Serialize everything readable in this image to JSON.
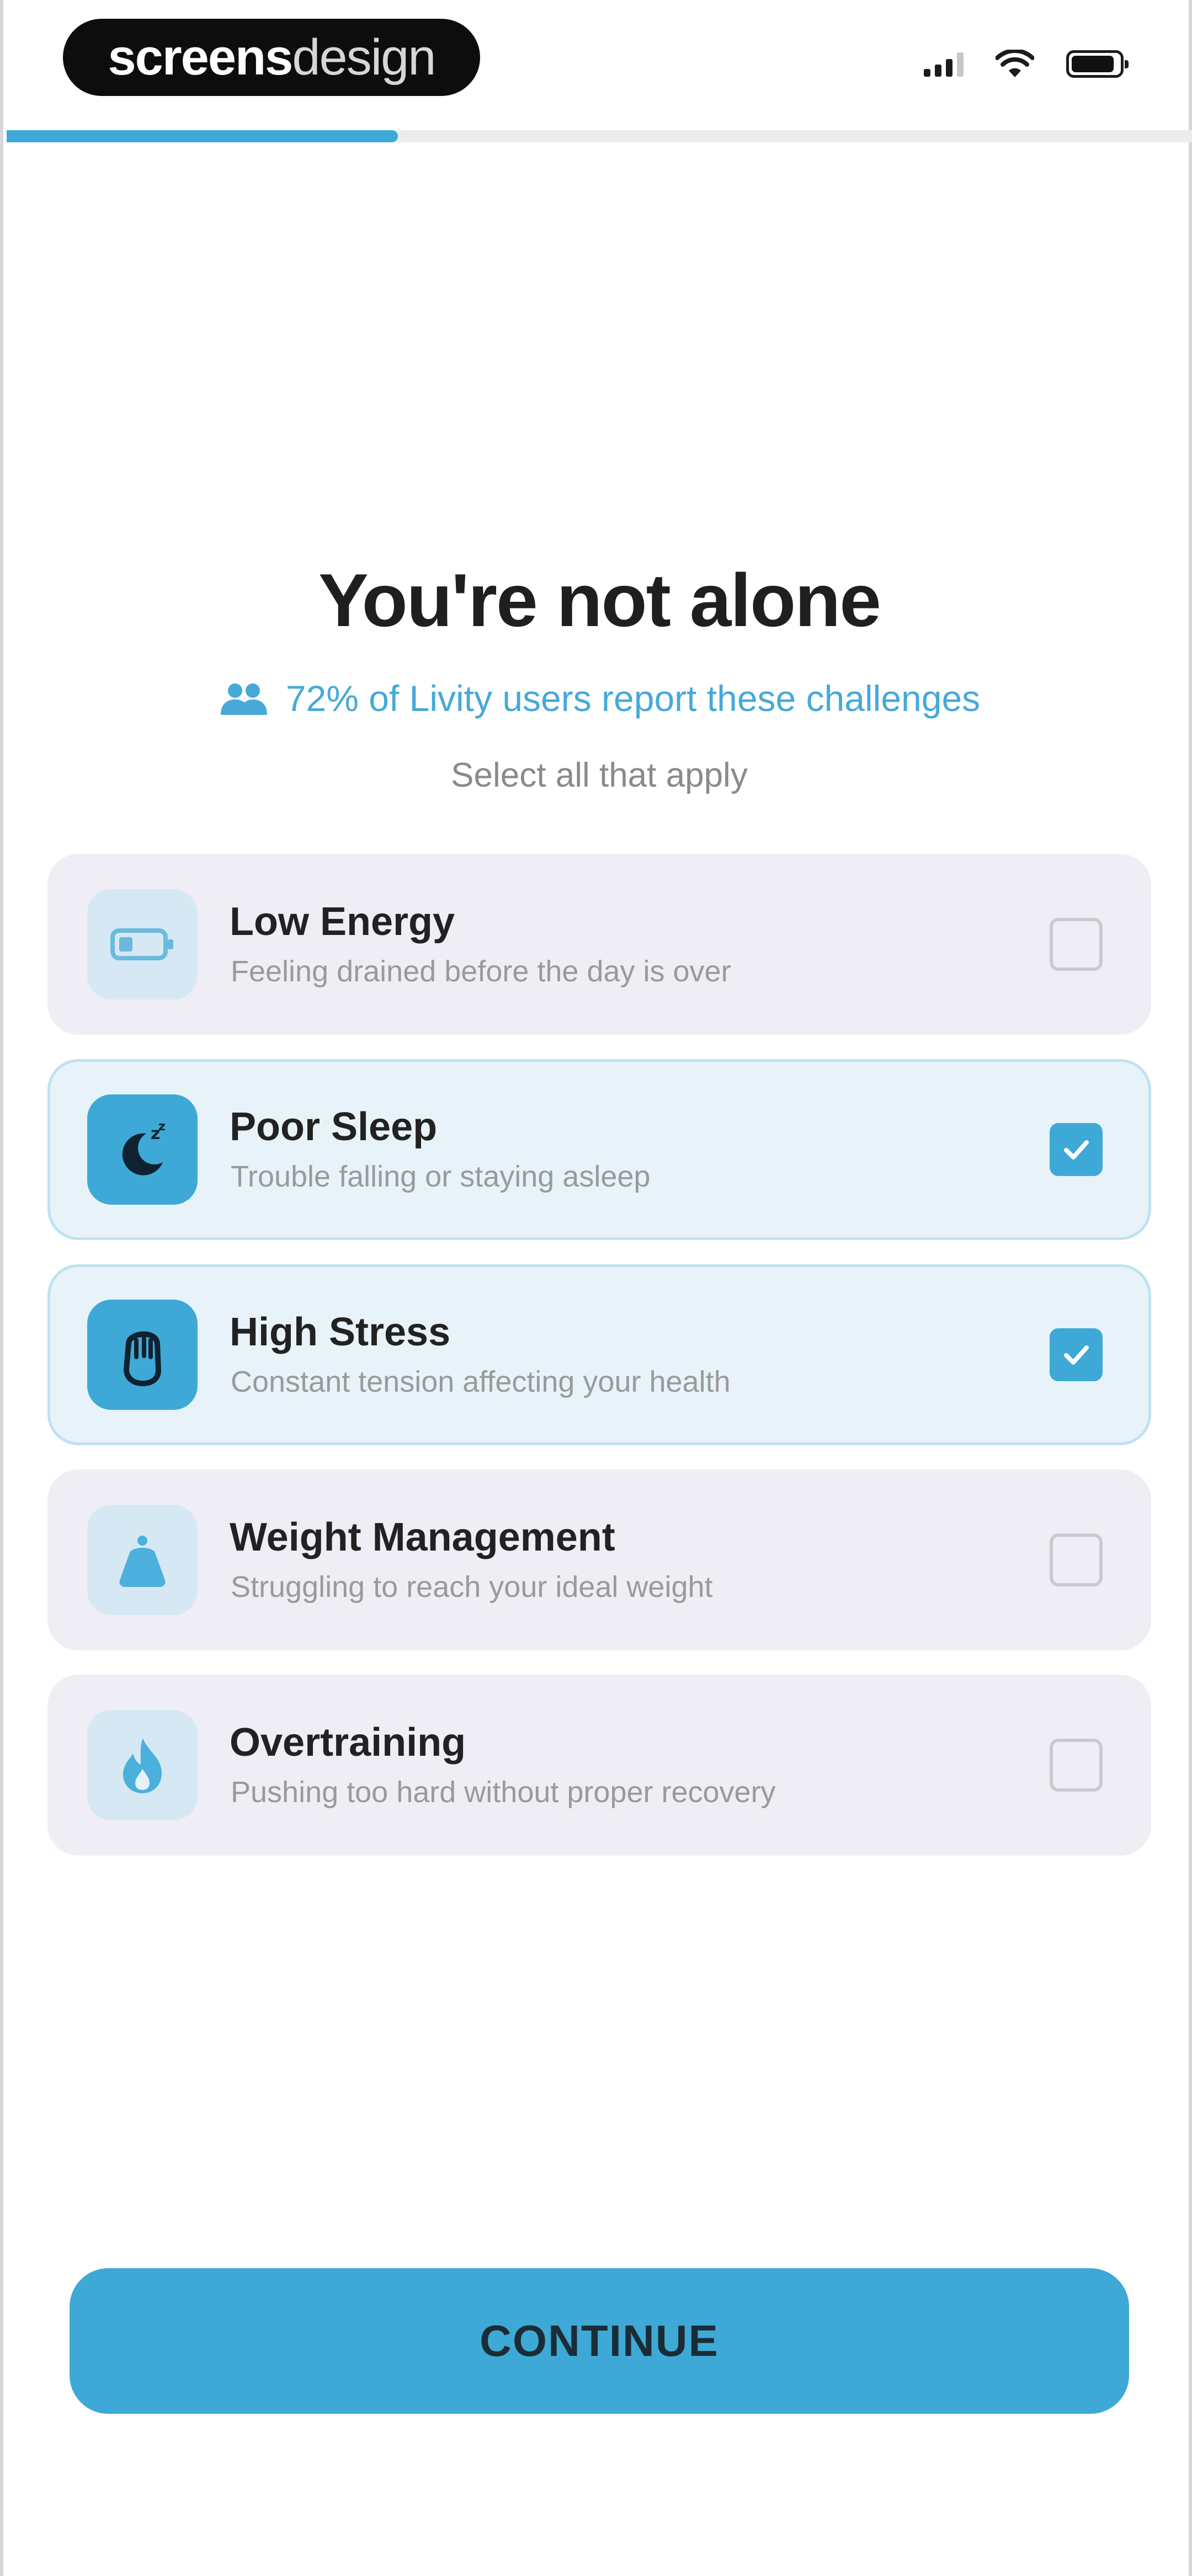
{
  "status_bar": {
    "brand_bold": "screens",
    "brand_light": "design"
  },
  "progress": {
    "fraction": 0.33
  },
  "header": {
    "title": "You're not alone",
    "stat": "72% of Livity users report these challenges",
    "hint": "Select all that apply"
  },
  "options": [
    {
      "title": "Low Energy",
      "subtitle": "Feeling drained before the day is over",
      "selected": false,
      "icon": "battery-low-icon"
    },
    {
      "title": "Poor Sleep",
      "subtitle": "Trouble falling or staying asleep",
      "selected": true,
      "icon": "moon-icon"
    },
    {
      "title": "High Stress",
      "subtitle": "Constant tension affecting your health",
      "selected": true,
      "icon": "stress-hand-icon"
    },
    {
      "title": "Weight Management",
      "subtitle": "Struggling to reach your ideal weight",
      "selected": false,
      "icon": "kettlebell-icon"
    },
    {
      "title": "Overtraining",
      "subtitle": "Pushing too hard without proper recovery",
      "selected": false,
      "icon": "flame-icon"
    }
  ],
  "footer": {
    "continue_label": "CONTINUE"
  },
  "colors": {
    "accent": "#3ea9d6",
    "card_bg": "#efeef4",
    "card_selected_bg": "#e7f3f9"
  }
}
